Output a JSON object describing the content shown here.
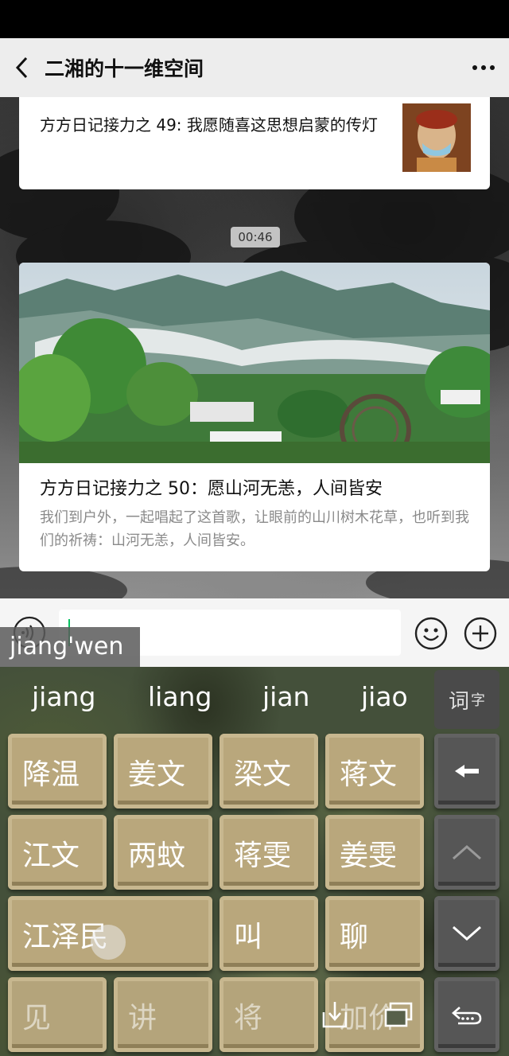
{
  "nav": {
    "title": "二湘的十一维空间"
  },
  "chat": {
    "card1": {
      "title": "方方日记接力之 49: 我愿随喜这思想启蒙的传灯"
    },
    "timestamp": "00:46",
    "card2": {
      "title": "方方日记接力之 50：愿山河无恙，人间皆安",
      "description": "我们到户外，一起唱起了这首歌，让眼前的山川树木花草，也听到我们的祈祷：山河无恙，人间皆安。"
    }
  },
  "input": {
    "composition": "jiang'wen"
  },
  "keyboard": {
    "pinyin_candidates": [
      "jiang",
      "liang",
      "jian",
      "jiao"
    ],
    "toggle_main": "词",
    "toggle_sub": "字",
    "word_keys": [
      "降温",
      "姜文",
      "梁文",
      "蒋文",
      "江文",
      "两蚊",
      "蒋雯",
      "姜雯",
      "江泽民",
      "叫",
      "聊",
      "见",
      "讲",
      "将",
      "加价"
    ]
  },
  "colors": {
    "wechat_green": "#07c160",
    "key_gold": "#b9a77c",
    "key_dark": "#565656",
    "nav_bg": "#ededed"
  },
  "icons": {
    "back": "chevron-left-icon",
    "more": "more-icon",
    "voice": "voice-icon",
    "emoji": "emoji-icon",
    "plus": "plus-icon",
    "backspace": "backspace-icon",
    "up": "chevron-up-icon",
    "down": "chevron-down-icon",
    "return": "return-icon",
    "download": "download-icon",
    "window": "window-icon"
  }
}
